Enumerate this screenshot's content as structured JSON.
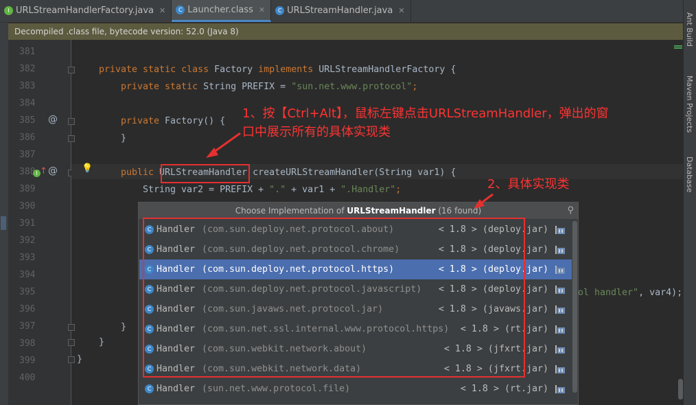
{
  "tabs": [
    {
      "label": "URLStreamHandlerFactory.java",
      "icon": "interface-lock-icon",
      "icon_color": "#62b543",
      "icon_letter": "I",
      "active": false
    },
    {
      "label": "Launcher.class",
      "icon": "class-icon",
      "icon_color": "#3d87c9",
      "icon_letter": "C",
      "active": true
    },
    {
      "label": "URLStreamHandler.java",
      "icon": "abstract-class-icon",
      "icon_color": "#3d87c9",
      "icon_letter": "C",
      "active": false
    }
  ],
  "tab_close_glyph": "✕",
  "banner": "Decompiled .class file, bytecode version: 52.0 (Java 8)",
  "right_tool_windows": [
    "Ant Build",
    "Maven Projects",
    "Database"
  ],
  "line_numbers": [
    "381",
    "382",
    "383",
    "384",
    "385",
    "386",
    "387",
    "388",
    "389",
    "390",
    "391",
    "392",
    "393",
    "394",
    "395",
    "396",
    "397",
    "398",
    "399",
    "400"
  ],
  "code": {
    "l382": {
      "kw1": "private static class ",
      "name": "Factory ",
      "kw2": "implements ",
      "rest": "URLStreamHandlerFactory {"
    },
    "l383": {
      "kw": "private static ",
      "type": "String PREFIX = ",
      "str": "\"sun.net.www.protocol\"",
      "end": ";"
    },
    "l385": {
      "kw": "private ",
      "rest": "Factory() {"
    },
    "l386": {
      "rest": "}"
    },
    "l388": {
      "kw": "public ",
      "type": "URLStreamHandler",
      "rest": " createURLStreamHandler(String var1) {"
    },
    "l389": {
      "a": "String var2 = PREFIX + ",
      "s1": "\".\"",
      "b": " + var1 + ",
      "s2": "\".Handler\"",
      "c": ";"
    },
    "l395_tail": {
      "str": "ol handler\"",
      "rest": ", var4);"
    },
    "l397": {
      "rest": "}"
    },
    "l398": {
      "rest": "}"
    },
    "l399": {
      "rest": "}"
    }
  },
  "gutter_icons": {
    "override_at": "@",
    "implements": "I",
    "up_arrow": "↑",
    "bulb": "💡"
  },
  "popup": {
    "title_prefix": "Choose Implementation of ",
    "title_name": "URLStreamHandler",
    "title_suffix": " (16 found)",
    "pin_glyph": "📌",
    "selected_index": 2,
    "items": [
      {
        "cls": "Handler",
        "pkg": "(com.sun.deploy.net.protocol.about)",
        "loc": "< 1.8 > (deploy.jar)"
      },
      {
        "cls": "Handler",
        "pkg": "(com.sun.deploy.net.protocol.chrome)",
        "loc": "< 1.8 > (deploy.jar)"
      },
      {
        "cls": "Handler",
        "pkg": "(com.sun.deploy.net.protocol.https)",
        "loc": "< 1.8 > (deploy.jar)"
      },
      {
        "cls": "Handler",
        "pkg": "(com.sun.deploy.net.protocol.javascript)",
        "loc": "< 1.8 > (deploy.jar)"
      },
      {
        "cls": "Handler",
        "pkg": "(com.sun.javaws.net.protocol.jar)",
        "loc": "< 1.8 > (javaws.jar)"
      },
      {
        "cls": "Handler",
        "pkg": "(com.sun.net.ssl.internal.www.protocol.https)",
        "loc": "< 1.8 > (rt.jar)"
      },
      {
        "cls": "Handler",
        "pkg": "(com.sun.webkit.network.about)",
        "loc": "< 1.8 > (jfxrt.jar)"
      },
      {
        "cls": "Handler",
        "pkg": "(com.sun.webkit.network.data)",
        "loc": "< 1.8 > (jfxrt.jar)"
      },
      {
        "cls": "Handler",
        "pkg": "(sun.net.www.protocol.file)",
        "loc": "< 1.8 > (rt.jar)"
      }
    ]
  },
  "annotations": {
    "note1_line1": "1、按【Ctrl+Alt】，鼠标左键点击URLStreamHandler，弹出的窗",
    "note1_line2": "口中展示所有的具体实现类",
    "note2": "2、具体实现类"
  },
  "colors": {
    "annotation": "#e53030",
    "selection": "#4b6eaf",
    "keyword": "#cc7832",
    "string": "#6a8759"
  }
}
